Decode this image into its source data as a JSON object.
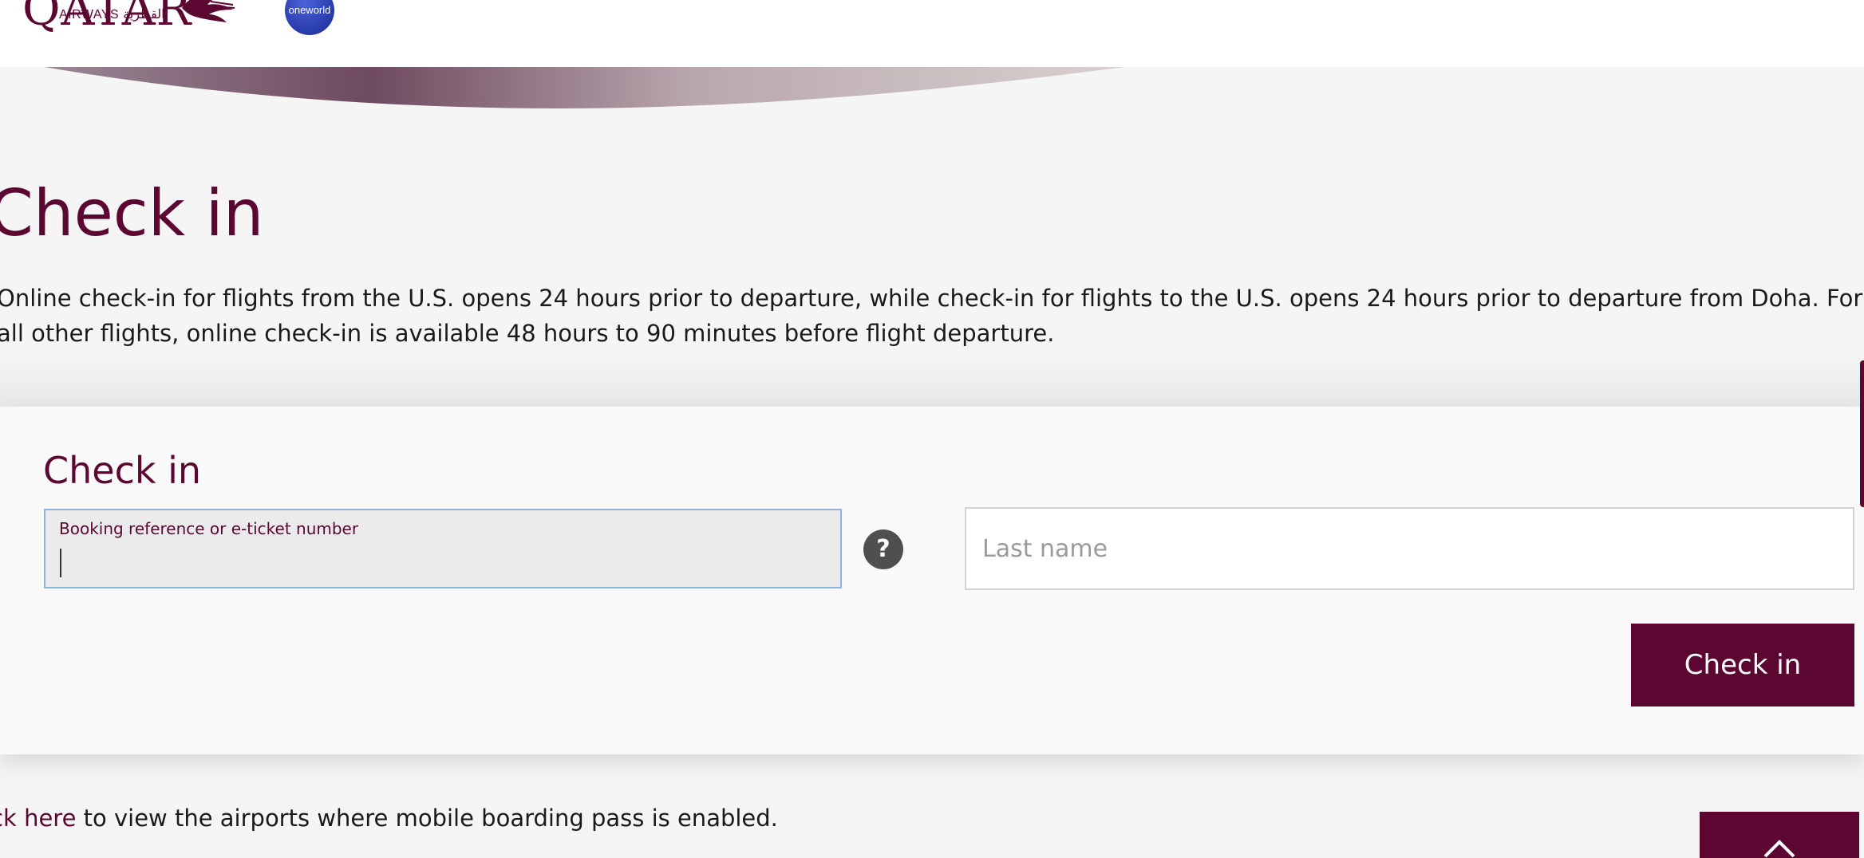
{
  "header": {
    "logo_text": "QATAR",
    "logo_sub": "AIRWAYS القطرية",
    "alliance_badge": "oneworld"
  },
  "page": {
    "title": "Check in",
    "intro": "Online check-in for flights from the U.S. opens 24 hours prior to departure, while check-in for flights to the U.S. opens 24 hours prior to departure from Doha. For all other flights, online check-in is available 48 hours to 90 minutes before flight departure."
  },
  "checkin_form": {
    "title": "Check in",
    "booking_label": "Booking reference or e-ticket number",
    "booking_value": "",
    "help_icon": "?",
    "lastname_placeholder": "Last name",
    "lastname_value": "",
    "submit_label": "Check in"
  },
  "footer": {
    "mobile_link": "lick here",
    "mobile_text": " to view the airports where mobile boarding pass is enabled."
  },
  "icons": {
    "logo": "oryx-logo-icon",
    "help": "question-mark-icon",
    "back_to_top": "chevron-up-icon"
  },
  "colors": {
    "brand": "#5c0632",
    "focus_border": "#8fb5dd",
    "help_icon_bg": "#4f4f4f"
  }
}
